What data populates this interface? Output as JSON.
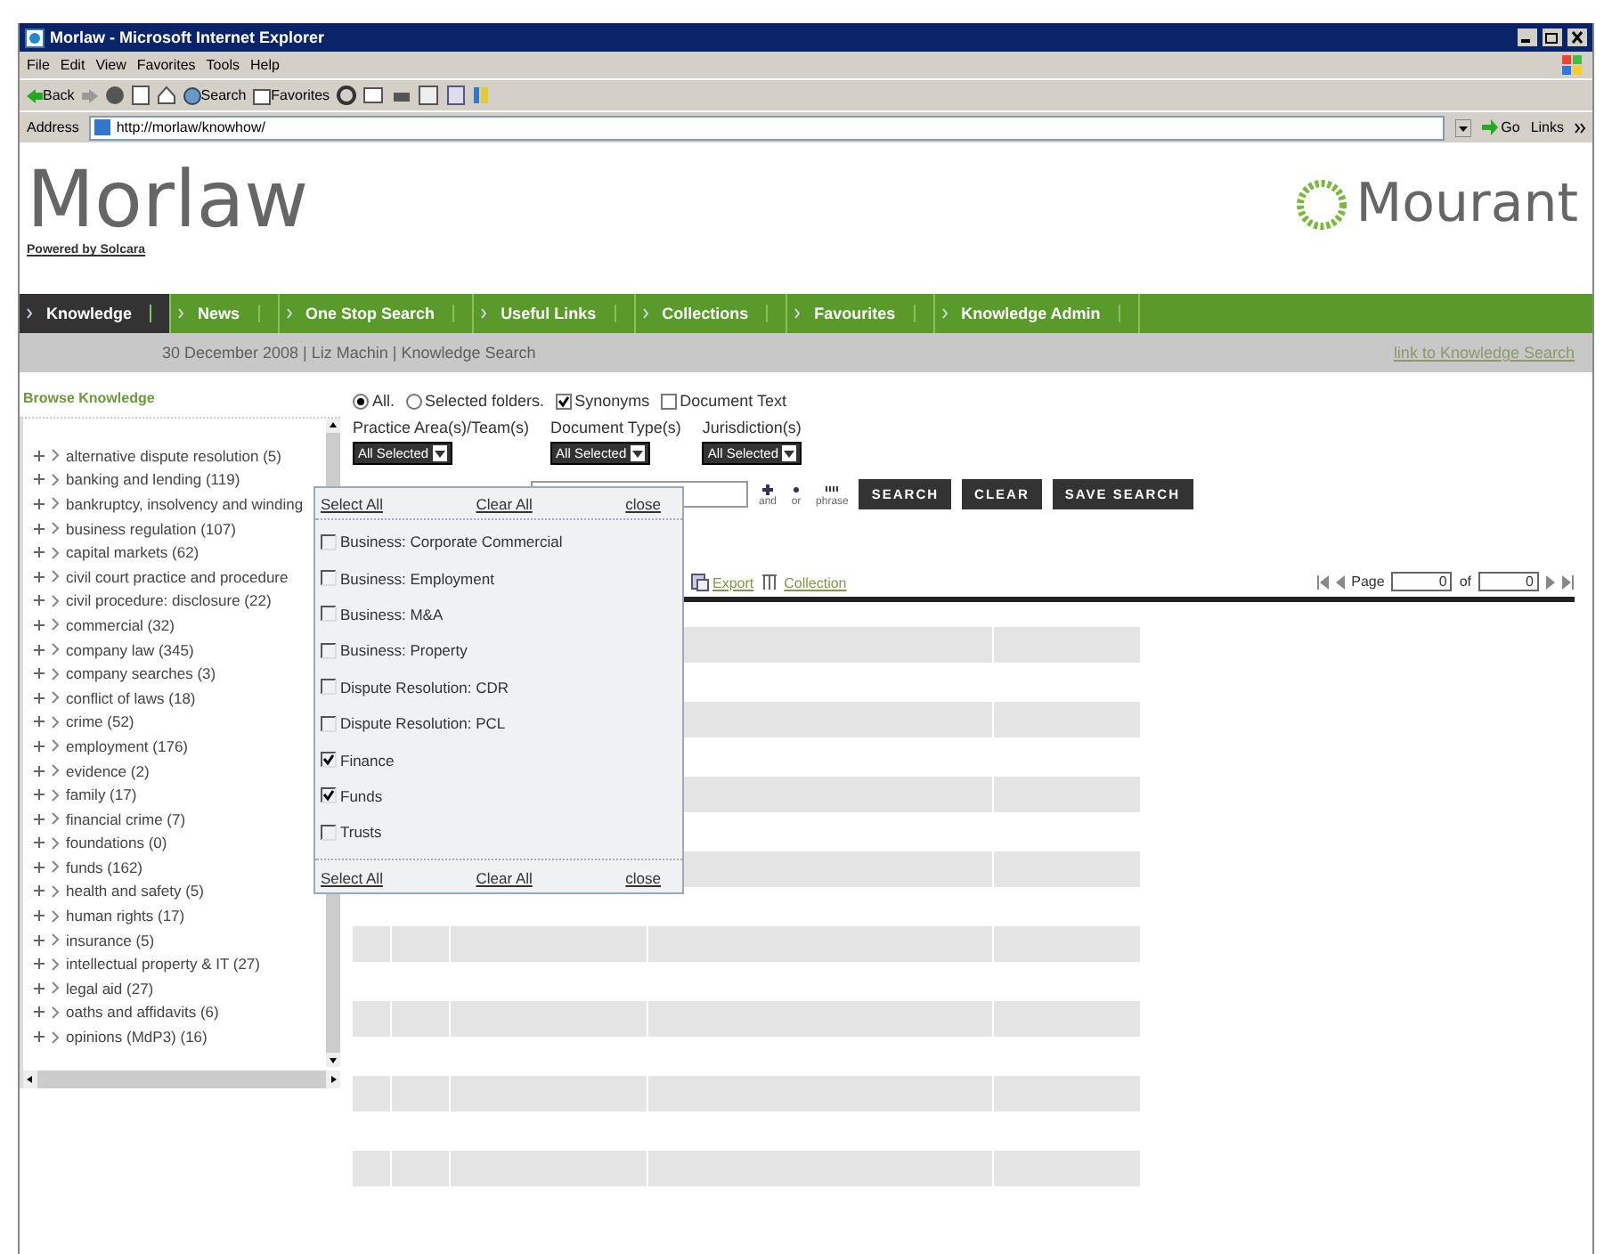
{
  "window": {
    "title": "Morlaw - Microsoft Internet Explorer"
  },
  "menu": [
    "File",
    "Edit",
    "View",
    "Favorites",
    "Tools",
    "Help"
  ],
  "toolbar": {
    "back": "Back",
    "search": "Search",
    "favorites": "Favorites"
  },
  "address_bar": {
    "label": "Address",
    "value": "http://morlaw/knowhow/",
    "go": "Go",
    "links": "Links"
  },
  "site": {
    "logo": "Morlaw",
    "tagline": "Powered by Solcara",
    "partner_logo": "Mourant"
  },
  "nav": [
    {
      "label": "Knowledge",
      "selected": true
    },
    {
      "label": "News",
      "selected": false
    },
    {
      "label": "One Stop Search",
      "selected": false
    },
    {
      "label": "Useful Links",
      "selected": false
    },
    {
      "label": "Collections",
      "selected": false
    },
    {
      "label": "Favourites",
      "selected": false
    },
    {
      "label": "Knowledge Admin",
      "selected": false
    }
  ],
  "info_bar": {
    "text": "30 December 2008 | Liz Machin | Knowledge Search",
    "link": "link to Knowledge Search"
  },
  "sidebar": {
    "title": "Browse Knowledge",
    "items": [
      {
        "label": "alternative dispute resolution (5)",
        "expanded": false
      },
      {
        "label": "banking and lending (119)",
        "expanded": false
      },
      {
        "label": "bankruptcy, insolvency and winding",
        "expanded": false
      },
      {
        "label": "business regulation (107)",
        "expanded": false
      },
      {
        "label": "capital markets (62)",
        "expanded": false
      },
      {
        "label": "civil court practice and procedure",
        "expanded": false
      },
      {
        "label": "civil procedure: disclosure (22)",
        "expanded": false
      },
      {
        "label": "commercial (32)",
        "expanded": false
      },
      {
        "label": "company law (345)",
        "expanded": false
      },
      {
        "label": "company searches (3)",
        "expanded": false
      },
      {
        "label": "conflict of laws (18)",
        "expanded": false
      },
      {
        "label": "crime (52)",
        "expanded": false
      },
      {
        "label": "employment (176)",
        "expanded": false
      },
      {
        "label": "evidence (2)",
        "expanded": false
      },
      {
        "label": "family (17)",
        "expanded": false
      },
      {
        "label": "financial crime (7)",
        "expanded": false
      },
      {
        "label": "foundations (0)",
        "expanded": false
      },
      {
        "label": "funds (162)",
        "expanded": false
      },
      {
        "label": "health and safety (5)",
        "expanded": false
      },
      {
        "label": "human rights (17)",
        "expanded": false
      },
      {
        "label": "insurance (5)",
        "expanded": false
      },
      {
        "label": "intellectual property & IT (27)",
        "expanded": false
      },
      {
        "label": "legal aid (27)",
        "expanded": false
      },
      {
        "label": "oaths and affidavits (6)",
        "expanded": false
      },
      {
        "label": "opinions (MdP3) (16)",
        "expanded": false
      }
    ]
  },
  "scope": [
    {
      "kind": "radio",
      "label": "All.",
      "checked": true
    },
    {
      "kind": "radio",
      "label": "Selected folders.",
      "checked": false
    },
    {
      "kind": "checkbox",
      "label": "Synonyms",
      "checked": true
    },
    {
      "kind": "checkbox",
      "label": "Document Text",
      "checked": false
    }
  ],
  "filters": [
    {
      "label": "Practice Area(s)/Team(s)",
      "value": "All Selected"
    },
    {
      "label": "Document Type(s)",
      "value": "All Selected"
    },
    {
      "label": "Jurisdiction(s)",
      "value": "All Selected"
    }
  ],
  "operators": [
    "and",
    "or",
    "phrase"
  ],
  "buttons": [
    "SEARCH",
    "CLEAR",
    "SAVE SEARCH"
  ],
  "results_toolbar": [
    "Export",
    "Collection"
  ],
  "pager": {
    "label": "Page",
    "page": "0",
    "of": "of",
    "total": "0"
  },
  "dropdown": {
    "actions": [
      "Select All",
      "Clear All",
      "close"
    ],
    "options": [
      {
        "label": "Business: Corporate Commercial",
        "checked": false
      },
      {
        "label": "Business: Employment",
        "checked": false
      },
      {
        "label": "Business: M&A",
        "checked": false
      },
      {
        "label": "Business: Property",
        "checked": false
      },
      {
        "label": "Dispute Resolution: CDR",
        "checked": false
      },
      {
        "label": "Dispute Resolution: PCL",
        "checked": false
      },
      {
        "label": "Finance",
        "checked": true
      },
      {
        "label": "Funds",
        "checked": true
      },
      {
        "label": "Trusts",
        "checked": false
      }
    ],
    "footer_actions": [
      "Select All",
      "Clear All",
      "close"
    ]
  }
}
